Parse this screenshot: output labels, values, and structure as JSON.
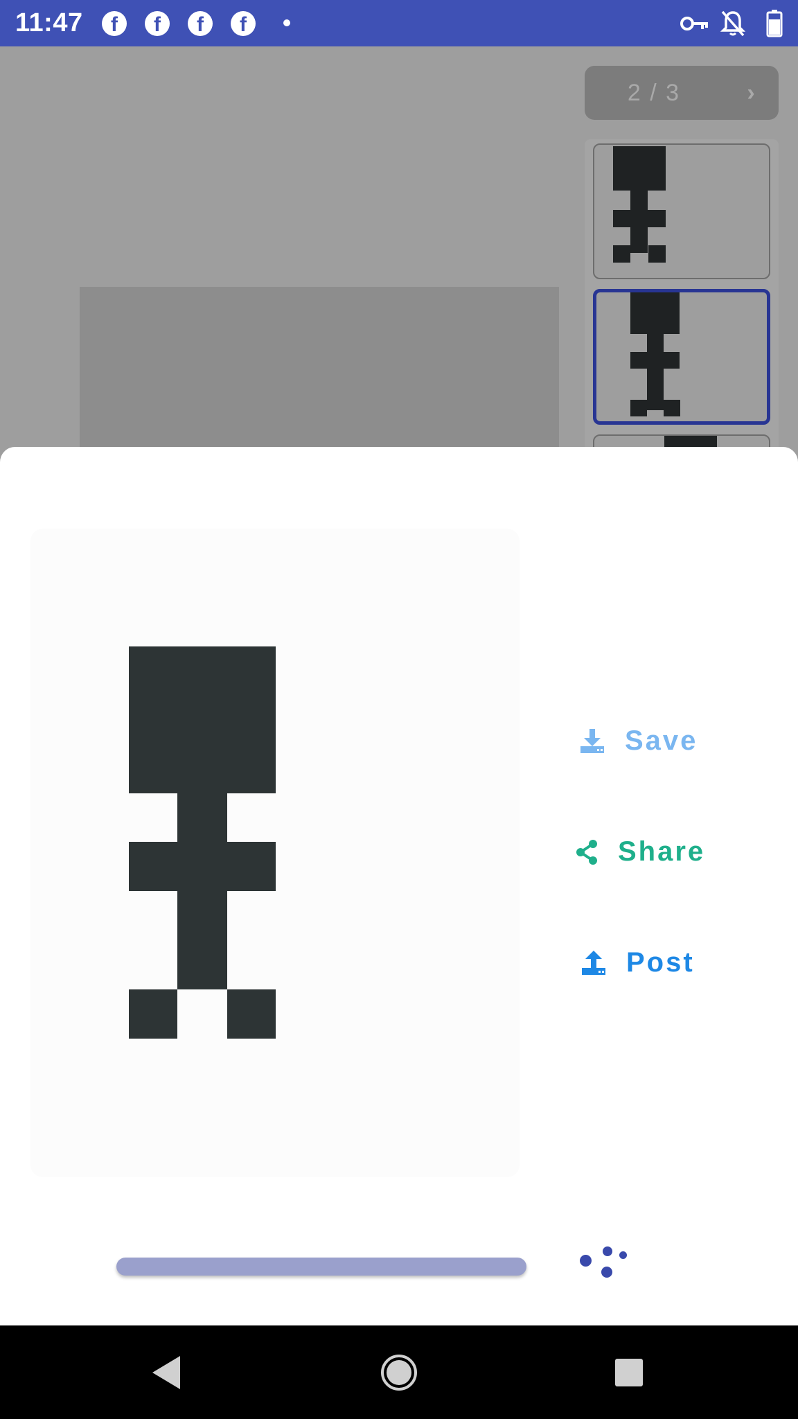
{
  "status_bar": {
    "time": "11:47",
    "notification_icons": [
      "facebook-icon",
      "facebook-icon",
      "facebook-icon",
      "facebook-icon",
      "more-notifications-dot"
    ],
    "system_icons": [
      "vpn-key-icon",
      "notifications-off-icon",
      "battery-icon"
    ],
    "background_color": "#3f51b5"
  },
  "background_app": {
    "pager": {
      "text": "2 / 3",
      "next_icon": "›"
    },
    "thumbnails_count": 3,
    "selected_thumbnail": 2,
    "selected_color": "#283593"
  },
  "sheet": {
    "actions": [
      {
        "label": "Save",
        "icon": "download-icon",
        "color": "#7ab6f0"
      },
      {
        "label": "Share",
        "icon": "share-icon",
        "color": "#1faf8b"
      },
      {
        "label": "Post",
        "icon": "upload-icon",
        "color": "#1e88e5"
      }
    ],
    "pixel_art_color": "#2d3435",
    "progress_color": "#9aa0cc",
    "spinner_color": "#3949ab"
  },
  "nav_bar": {
    "buttons": [
      "back-icon",
      "home-icon",
      "recents-icon"
    ]
  }
}
